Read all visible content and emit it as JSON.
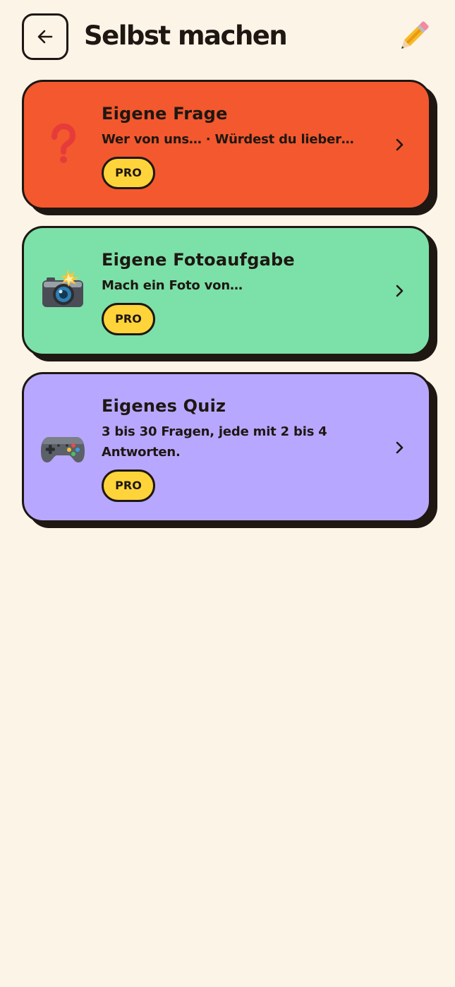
{
  "header": {
    "title": "Selbst machen",
    "back_icon": "arrow-left-icon",
    "corner_icon": "pencil-icon"
  },
  "cards": [
    {
      "title": "Eigene Frage",
      "subtitle": "Wer von uns… · Würdest du lieber…",
      "badge": "PRO",
      "icon": "question-mark-icon",
      "color": "#f3582e"
    },
    {
      "title": "Eigene Fotoaufgabe",
      "subtitle": "Mach ein Foto von…",
      "badge": "PRO",
      "icon": "camera-flash-icon",
      "color": "#7ce0a9"
    },
    {
      "title": "Eigenes Quiz",
      "subtitle": "3 bis 30 Fragen, jede mit 2 bis 4 Antworten.",
      "badge": "PRO",
      "icon": "game-controller-icon",
      "color": "#b8a7ff"
    }
  ],
  "colors": {
    "background": "#fdf4e8",
    "ink": "#1e1712",
    "badge": "#ffd43a"
  }
}
